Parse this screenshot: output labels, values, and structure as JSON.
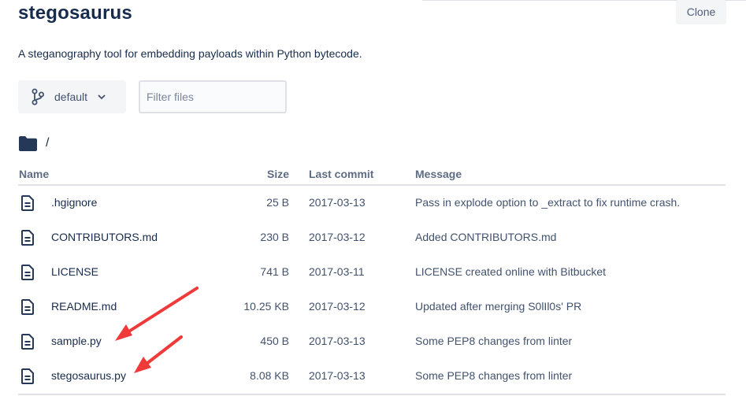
{
  "repo": {
    "title": "stegosaurus",
    "description": "A steganography tool for embedding payloads within Python bytecode.",
    "clone_label": "Clone"
  },
  "toolbar": {
    "branch_label": "default",
    "filter_placeholder": "Filter files"
  },
  "path": {
    "current": "/"
  },
  "table": {
    "headers": {
      "name": "Name",
      "size": "Size",
      "last_commit": "Last commit",
      "message": "Message"
    },
    "rows": [
      {
        "name": ".hgignore",
        "size": "25 B",
        "date": "2017-03-13",
        "message": "Pass in explode option to _extract to fix runtime crash."
      },
      {
        "name": "CONTRIBUTORS.md",
        "size": "230 B",
        "date": "2017-03-12",
        "message": "Added CONTRIBUTORS.md"
      },
      {
        "name": "LICENSE",
        "size": "741 B",
        "date": "2017-03-11",
        "message": "LICENSE created online with Bitbucket"
      },
      {
        "name": "README.md",
        "size": "10.25 KB",
        "date": "2017-03-12",
        "message": "Updated after merging S0lIl0s' PR"
      },
      {
        "name": "sample.py",
        "size": "450 B",
        "date": "2017-03-13",
        "message": "Some PEP8 changes from linter"
      },
      {
        "name": "stegosaurus.py",
        "size": "8.08 KB",
        "date": "2017-03-13",
        "message": "Some PEP8 changes from linter"
      }
    ]
  },
  "icons": {
    "folder": "folder-icon",
    "file": "file-icon",
    "branch": "branch-icon",
    "chevron": "chevron-down-icon"
  },
  "colors": {
    "annotation_arrow": "#f03a3a",
    "heading": "#172b4d",
    "icon": "#253858"
  }
}
